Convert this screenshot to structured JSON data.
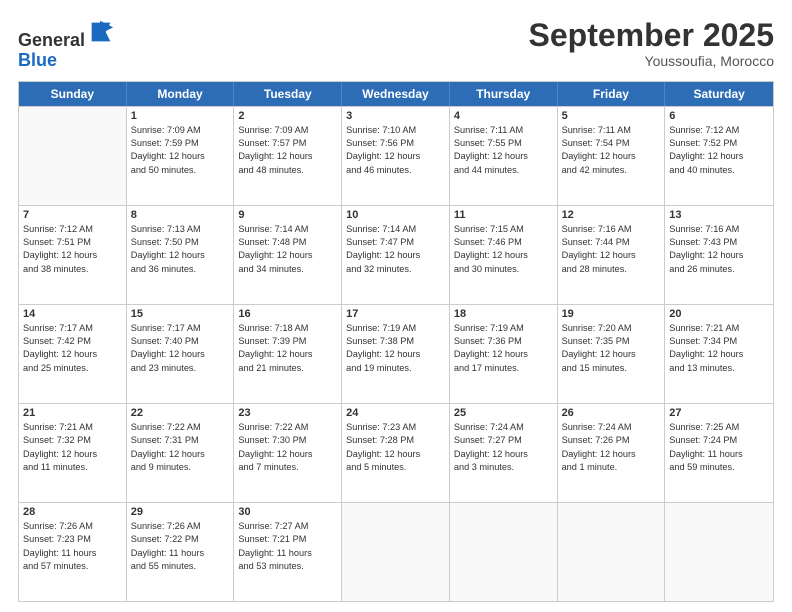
{
  "header": {
    "logo_line1": "General",
    "logo_line2": "Blue",
    "month": "September 2025",
    "location": "Youssoufia, Morocco"
  },
  "weekdays": [
    "Sunday",
    "Monday",
    "Tuesday",
    "Wednesday",
    "Thursday",
    "Friday",
    "Saturday"
  ],
  "rows": [
    [
      {
        "day": "",
        "lines": []
      },
      {
        "day": "1",
        "lines": [
          "Sunrise: 7:09 AM",
          "Sunset: 7:59 PM",
          "Daylight: 12 hours",
          "and 50 minutes."
        ]
      },
      {
        "day": "2",
        "lines": [
          "Sunrise: 7:09 AM",
          "Sunset: 7:57 PM",
          "Daylight: 12 hours",
          "and 48 minutes."
        ]
      },
      {
        "day": "3",
        "lines": [
          "Sunrise: 7:10 AM",
          "Sunset: 7:56 PM",
          "Daylight: 12 hours",
          "and 46 minutes."
        ]
      },
      {
        "day": "4",
        "lines": [
          "Sunrise: 7:11 AM",
          "Sunset: 7:55 PM",
          "Daylight: 12 hours",
          "and 44 minutes."
        ]
      },
      {
        "day": "5",
        "lines": [
          "Sunrise: 7:11 AM",
          "Sunset: 7:54 PM",
          "Daylight: 12 hours",
          "and 42 minutes."
        ]
      },
      {
        "day": "6",
        "lines": [
          "Sunrise: 7:12 AM",
          "Sunset: 7:52 PM",
          "Daylight: 12 hours",
          "and 40 minutes."
        ]
      }
    ],
    [
      {
        "day": "7",
        "lines": [
          "Sunrise: 7:12 AM",
          "Sunset: 7:51 PM",
          "Daylight: 12 hours",
          "and 38 minutes."
        ]
      },
      {
        "day": "8",
        "lines": [
          "Sunrise: 7:13 AM",
          "Sunset: 7:50 PM",
          "Daylight: 12 hours",
          "and 36 minutes."
        ]
      },
      {
        "day": "9",
        "lines": [
          "Sunrise: 7:14 AM",
          "Sunset: 7:48 PM",
          "Daylight: 12 hours",
          "and 34 minutes."
        ]
      },
      {
        "day": "10",
        "lines": [
          "Sunrise: 7:14 AM",
          "Sunset: 7:47 PM",
          "Daylight: 12 hours",
          "and 32 minutes."
        ]
      },
      {
        "day": "11",
        "lines": [
          "Sunrise: 7:15 AM",
          "Sunset: 7:46 PM",
          "Daylight: 12 hours",
          "and 30 minutes."
        ]
      },
      {
        "day": "12",
        "lines": [
          "Sunrise: 7:16 AM",
          "Sunset: 7:44 PM",
          "Daylight: 12 hours",
          "and 28 minutes."
        ]
      },
      {
        "day": "13",
        "lines": [
          "Sunrise: 7:16 AM",
          "Sunset: 7:43 PM",
          "Daylight: 12 hours",
          "and 26 minutes."
        ]
      }
    ],
    [
      {
        "day": "14",
        "lines": [
          "Sunrise: 7:17 AM",
          "Sunset: 7:42 PM",
          "Daylight: 12 hours",
          "and 25 minutes."
        ]
      },
      {
        "day": "15",
        "lines": [
          "Sunrise: 7:17 AM",
          "Sunset: 7:40 PM",
          "Daylight: 12 hours",
          "and 23 minutes."
        ]
      },
      {
        "day": "16",
        "lines": [
          "Sunrise: 7:18 AM",
          "Sunset: 7:39 PM",
          "Daylight: 12 hours",
          "and 21 minutes."
        ]
      },
      {
        "day": "17",
        "lines": [
          "Sunrise: 7:19 AM",
          "Sunset: 7:38 PM",
          "Daylight: 12 hours",
          "and 19 minutes."
        ]
      },
      {
        "day": "18",
        "lines": [
          "Sunrise: 7:19 AM",
          "Sunset: 7:36 PM",
          "Daylight: 12 hours",
          "and 17 minutes."
        ]
      },
      {
        "day": "19",
        "lines": [
          "Sunrise: 7:20 AM",
          "Sunset: 7:35 PM",
          "Daylight: 12 hours",
          "and 15 minutes."
        ]
      },
      {
        "day": "20",
        "lines": [
          "Sunrise: 7:21 AM",
          "Sunset: 7:34 PM",
          "Daylight: 12 hours",
          "and 13 minutes."
        ]
      }
    ],
    [
      {
        "day": "21",
        "lines": [
          "Sunrise: 7:21 AM",
          "Sunset: 7:32 PM",
          "Daylight: 12 hours",
          "and 11 minutes."
        ]
      },
      {
        "day": "22",
        "lines": [
          "Sunrise: 7:22 AM",
          "Sunset: 7:31 PM",
          "Daylight: 12 hours",
          "and 9 minutes."
        ]
      },
      {
        "day": "23",
        "lines": [
          "Sunrise: 7:22 AM",
          "Sunset: 7:30 PM",
          "Daylight: 12 hours",
          "and 7 minutes."
        ]
      },
      {
        "day": "24",
        "lines": [
          "Sunrise: 7:23 AM",
          "Sunset: 7:28 PM",
          "Daylight: 12 hours",
          "and 5 minutes."
        ]
      },
      {
        "day": "25",
        "lines": [
          "Sunrise: 7:24 AM",
          "Sunset: 7:27 PM",
          "Daylight: 12 hours",
          "and 3 minutes."
        ]
      },
      {
        "day": "26",
        "lines": [
          "Sunrise: 7:24 AM",
          "Sunset: 7:26 PM",
          "Daylight: 12 hours",
          "and 1 minute."
        ]
      },
      {
        "day": "27",
        "lines": [
          "Sunrise: 7:25 AM",
          "Sunset: 7:24 PM",
          "Daylight: 11 hours",
          "and 59 minutes."
        ]
      }
    ],
    [
      {
        "day": "28",
        "lines": [
          "Sunrise: 7:26 AM",
          "Sunset: 7:23 PM",
          "Daylight: 11 hours",
          "and 57 minutes."
        ]
      },
      {
        "day": "29",
        "lines": [
          "Sunrise: 7:26 AM",
          "Sunset: 7:22 PM",
          "Daylight: 11 hours",
          "and 55 minutes."
        ]
      },
      {
        "day": "30",
        "lines": [
          "Sunrise: 7:27 AM",
          "Sunset: 7:21 PM",
          "Daylight: 11 hours",
          "and 53 minutes."
        ]
      },
      {
        "day": "",
        "lines": []
      },
      {
        "day": "",
        "lines": []
      },
      {
        "day": "",
        "lines": []
      },
      {
        "day": "",
        "lines": []
      }
    ]
  ]
}
